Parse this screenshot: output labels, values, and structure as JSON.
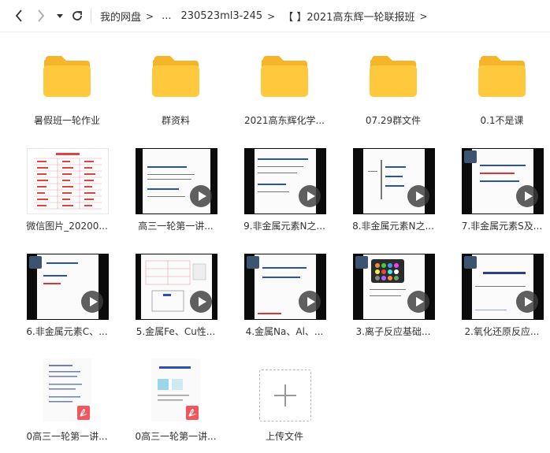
{
  "breadcrumb": {
    "items": [
      "我的网盘",
      "...",
      "230523ml3-245",
      "【 】2021高东辉一轮联报班"
    ],
    "separator": ">"
  },
  "toolbar": {
    "back": "back-arrow-icon",
    "forward": "forward-arrow-icon",
    "history": "history-dropdown-icon",
    "refresh": "refresh-icon"
  },
  "colors": {
    "folder": "#FFC83D",
    "folder_tab": "#F5B52B",
    "pdf_badge": "#F0565B",
    "play_overlay": "#3C3C3C"
  },
  "files": [
    {
      "name": "暑假班一轮作业",
      "type": "folder"
    },
    {
      "name": "群资料",
      "type": "folder"
    },
    {
      "name": "2021高东辉化学...",
      "type": "folder"
    },
    {
      "name": "07.29群文件",
      "type": "folder"
    },
    {
      "name": "0.1不是课",
      "type": "folder"
    },
    {
      "name": "微信图片_20200...",
      "type": "image"
    },
    {
      "name": "高三一轮第一讲...",
      "type": "video"
    },
    {
      "name": "9.非金属元素N之...",
      "type": "video"
    },
    {
      "name": "8.非金属元素N之...",
      "type": "video"
    },
    {
      "name": "7.非金属元素S及...",
      "type": "video"
    },
    {
      "name": "6.非金属元素C、...",
      "type": "video"
    },
    {
      "name": "5.金属Fe、Cu性...",
      "type": "video"
    },
    {
      "name": "4.金属Na、Al、...",
      "type": "video"
    },
    {
      "name": "3.离子反应基础...",
      "type": "video"
    },
    {
      "name": "2.氧化还原反应...",
      "type": "video"
    },
    {
      "name": "0高三一轮第一讲...",
      "type": "pdf"
    },
    {
      "name": "0高三一轮第一讲...",
      "type": "pdf"
    },
    {
      "name": "上传文件",
      "type": "upload"
    }
  ]
}
